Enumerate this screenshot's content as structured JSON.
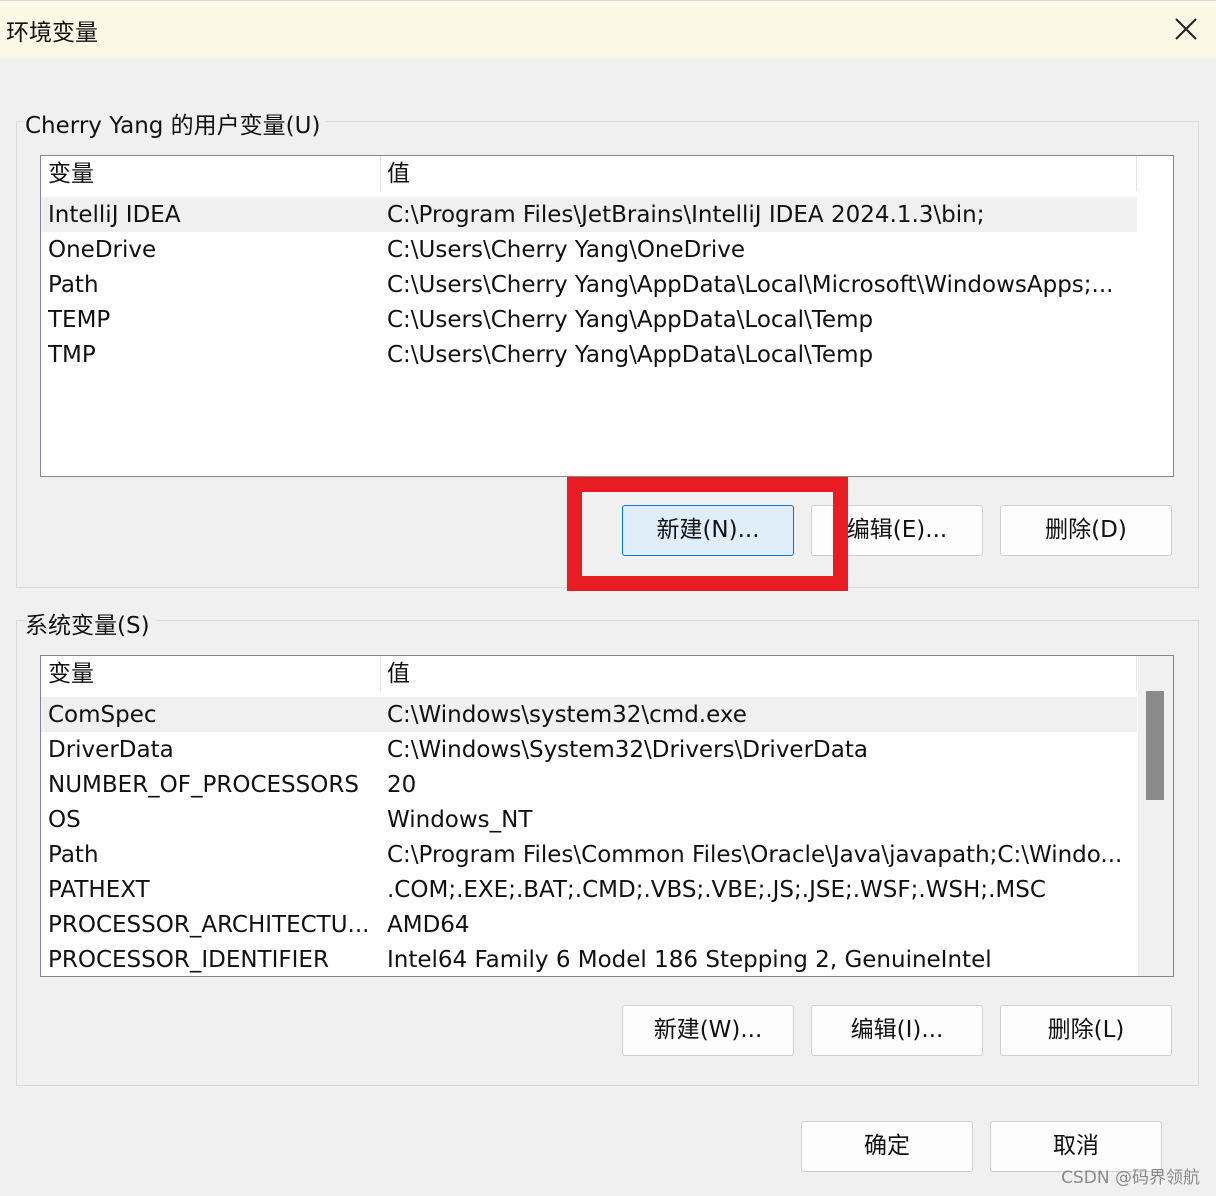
{
  "window": {
    "title": "环境变量"
  },
  "user_vars": {
    "group_label": "Cherry Yang 的用户变量(U)",
    "headers": {
      "variable": "变量",
      "value": "值"
    },
    "rows": [
      {
        "name": "IntelliJ IDEA",
        "value": "C:\\Program Files\\JetBrains\\IntelliJ IDEA 2024.1.3\\bin;"
      },
      {
        "name": "OneDrive",
        "value": "C:\\Users\\Cherry Yang\\OneDrive"
      },
      {
        "name": "Path",
        "value": "C:\\Users\\Cherry Yang\\AppData\\Local\\Microsoft\\WindowsApps;..."
      },
      {
        "name": "TEMP",
        "value": "C:\\Users\\Cherry Yang\\AppData\\Local\\Temp"
      },
      {
        "name": "TMP",
        "value": "C:\\Users\\Cherry Yang\\AppData\\Local\\Temp"
      }
    ],
    "buttons": {
      "new": "新建(N)...",
      "edit": "编辑(E)...",
      "delete": "删除(D)"
    }
  },
  "system_vars": {
    "group_label": "系统变量(S)",
    "headers": {
      "variable": "变量",
      "value": "值"
    },
    "rows": [
      {
        "name": "ComSpec",
        "value": "C:\\Windows\\system32\\cmd.exe"
      },
      {
        "name": "DriverData",
        "value": "C:\\Windows\\System32\\Drivers\\DriverData"
      },
      {
        "name": "NUMBER_OF_PROCESSORS",
        "value": "20"
      },
      {
        "name": "OS",
        "value": "Windows_NT"
      },
      {
        "name": "Path",
        "value": "C:\\Program Files\\Common Files\\Oracle\\Java\\javapath;C:\\Windo..."
      },
      {
        "name": "PATHEXT",
        "value": ".COM;.EXE;.BAT;.CMD;.VBS;.VBE;.JS;.JSE;.WSF;.WSH;.MSC"
      },
      {
        "name": "PROCESSOR_ARCHITECTU...",
        "value": "AMD64"
      },
      {
        "name": "PROCESSOR_IDENTIFIER",
        "value": "Intel64 Family 6 Model 186 Stepping 2, GenuineIntel"
      }
    ],
    "buttons": {
      "new": "新建(W)...",
      "edit": "编辑(I)...",
      "delete": "删除(L)"
    }
  },
  "footer": {
    "ok": "确定",
    "cancel": "取消"
  },
  "watermark": "CSDN @码界领航",
  "colors": {
    "highlight": "#e81c23",
    "focus_border": "#0078d4"
  }
}
